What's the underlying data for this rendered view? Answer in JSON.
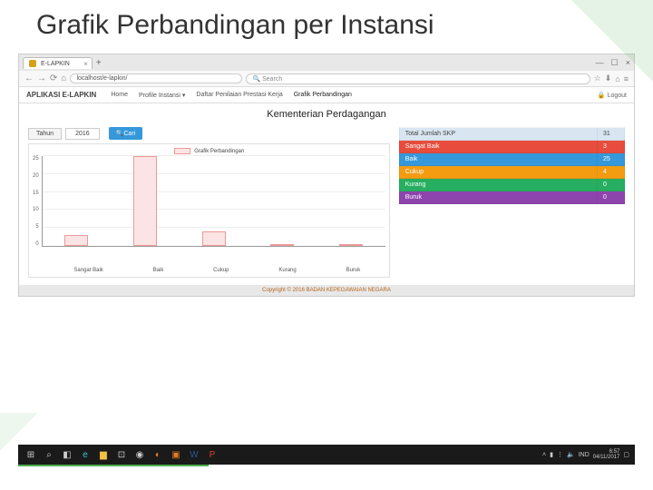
{
  "slide": {
    "title": "Grafik Perbandingan per Instansi"
  },
  "browser": {
    "tab_title": "E-LAPKIN",
    "tab_add": "+",
    "win_min": "—",
    "win_max": "☐",
    "win_close": "×",
    "url": "localhost/e-lapkin/",
    "search_placeholder": "Search",
    "icons": {
      "back": "←",
      "fwd": "→",
      "reload": "⟳",
      "home": "⌂",
      "mag": "🔍",
      "star": "☆",
      "dl": "⬇",
      "menu": "≡"
    }
  },
  "app": {
    "brand": "APLIKASI E-LAPKIN",
    "nav": {
      "home": "Home",
      "profile": "Profile Instansi ▾",
      "daftar": "Daftar Penilaian Prestasi Kerja",
      "grafik": "Grafik Perbandingan"
    },
    "logout": "Logout"
  },
  "content": {
    "title": "Kementerian Perdagangan",
    "filter": {
      "label": "Tahun",
      "value": "2016",
      "button": "Cari",
      "button_icon": "🔍"
    },
    "legend": "Grafik Perbandingan"
  },
  "chart_data": {
    "type": "bar",
    "categories": [
      "Sangat Baik",
      "Baik",
      "Cukup",
      "Kurang",
      "Buruk"
    ],
    "values": [
      3,
      25,
      4,
      0,
      0
    ],
    "title": "Grafik Perbandingan",
    "xlabel": "",
    "ylabel": "",
    "ylim": [
      0,
      25
    ],
    "yticks": [
      0,
      5,
      10,
      15,
      20,
      25
    ]
  },
  "stats": {
    "rows": [
      {
        "label": "Total Jumlah SKP",
        "value": "31",
        "cls": "row-total"
      },
      {
        "label": "Sangat Baik",
        "value": "3",
        "cls": "row-sb"
      },
      {
        "label": "Baik",
        "value": "25",
        "cls": "row-baik"
      },
      {
        "label": "Cukup",
        "value": "4",
        "cls": "row-cukup"
      },
      {
        "label": "Kurang",
        "value": "0",
        "cls": "row-kurang"
      },
      {
        "label": "Buruk",
        "value": "0",
        "cls": "row-buruk"
      }
    ]
  },
  "footer": "Copyright © 2016 BADAN KEPEGAWAIAN NEGARA",
  "taskbar": {
    "tray_lang": "IND",
    "time": "6:57",
    "date": "04/11/2017"
  }
}
